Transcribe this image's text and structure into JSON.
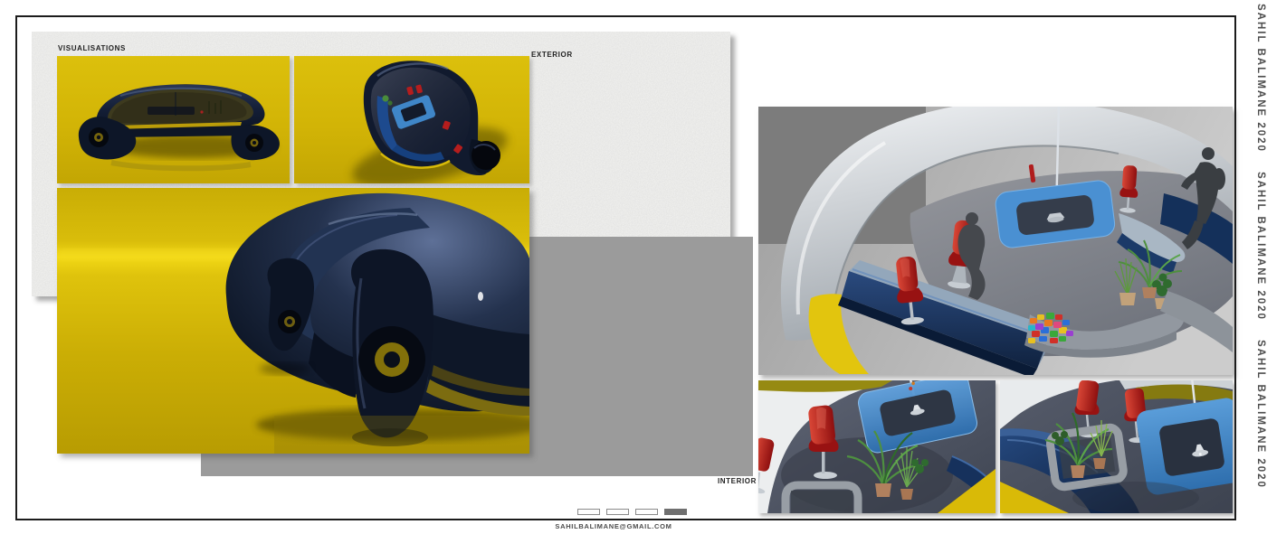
{
  "page": {
    "title": "VISUALISATIONS",
    "sections": {
      "exterior_label": "EXTERIOR",
      "interior_label": "INTERIOR"
    },
    "footer": {
      "email": "SAHILBALIMANE@GMAIL.COM"
    },
    "credit": {
      "items": [
        "SAHIL BALIMANE 2020",
        "SAHIL BALIMANE 2020",
        "SAHIL BALIMANE 2020"
      ]
    },
    "pagination": {
      "count": 4,
      "active_index": 3
    },
    "colors": {
      "car_yellow": "#d6b808",
      "car_navy": "#121b2f",
      "chair_red": "#b11d1d",
      "table_blue": "#4a90d2",
      "backdrop_gray": "#9b9b9b",
      "paper_texture": "#f3f3f1",
      "frame_black": "#1c1c1c"
    }
  }
}
